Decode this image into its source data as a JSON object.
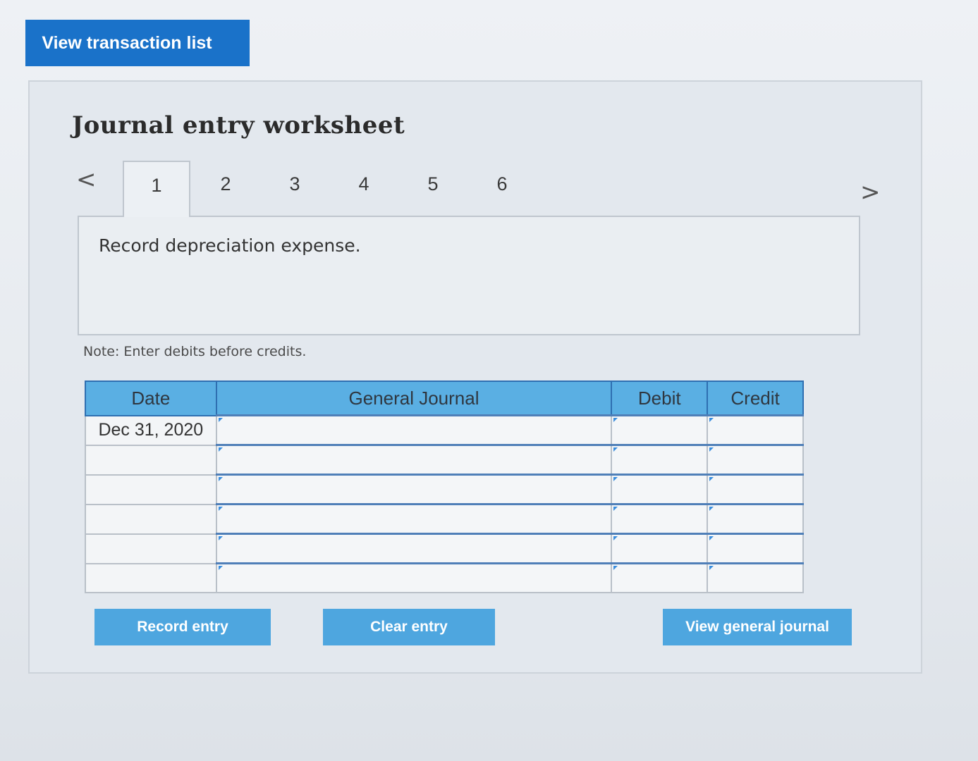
{
  "top": {
    "view_transactions_label": "View transaction list"
  },
  "worksheet": {
    "title": "Journal entry worksheet",
    "tabs": [
      {
        "label": "1",
        "active": true
      },
      {
        "label": "2",
        "active": false
      },
      {
        "label": "3",
        "active": false
      },
      {
        "label": "4",
        "active": false
      },
      {
        "label": "5",
        "active": false
      },
      {
        "label": "6",
        "active": false
      }
    ],
    "prev_glyph": "<",
    "next_glyph": ">",
    "task": "Record depreciation expense.",
    "note": "Note: Enter debits before credits."
  },
  "journal": {
    "headers": {
      "date": "Date",
      "general_journal": "General Journal",
      "debit": "Debit",
      "credit": "Credit"
    },
    "rows": [
      {
        "date": "Dec 31, 2020",
        "account": "",
        "debit": "",
        "credit": ""
      },
      {
        "date": "",
        "account": "",
        "debit": "",
        "credit": ""
      },
      {
        "date": "",
        "account": "",
        "debit": "",
        "credit": ""
      },
      {
        "date": "",
        "account": "",
        "debit": "",
        "credit": ""
      },
      {
        "date": "",
        "account": "",
        "debit": "",
        "credit": ""
      },
      {
        "date": "",
        "account": "",
        "debit": "",
        "credit": ""
      }
    ]
  },
  "buttons": {
    "record": "Record entry",
    "clear": "Clear entry",
    "view_journal": "View general journal"
  },
  "colors": {
    "primary_button": "#1a72c9",
    "secondary_button": "#4ea6df",
    "table_header": "#5aafe3"
  }
}
